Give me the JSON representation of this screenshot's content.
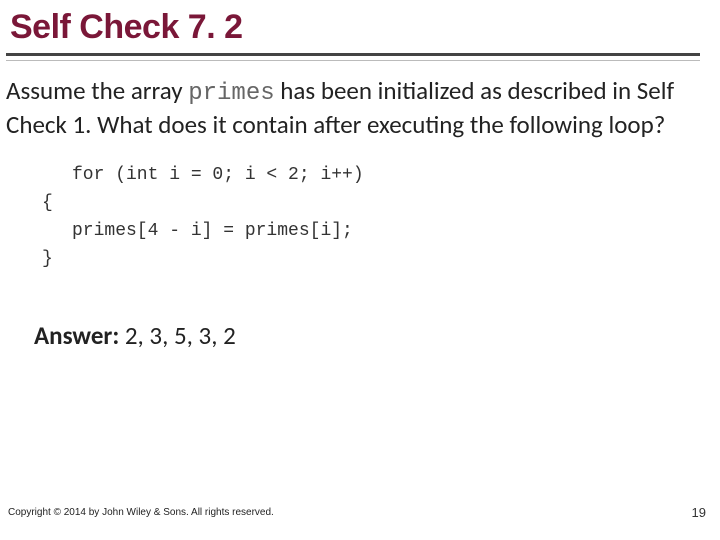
{
  "title": "Self Check 7. 2",
  "question": {
    "prefix": "Assume the array ",
    "ident": "primes",
    "suffix": " has been initialized as described in Self Check 1. What does it contain after executing the following loop?"
  },
  "code": {
    "line1": "for (int i = 0; i < 2; i++)",
    "open": "{",
    "line2": "primes[4 - i] = primes[i];",
    "close": "}"
  },
  "answer_label": "Answer:",
  "answer_value": " 2, 3, 5, 3, 2",
  "copyright": "Copyright © 2014 by John Wiley & Sons. All rights reserved.",
  "page_number": "19"
}
